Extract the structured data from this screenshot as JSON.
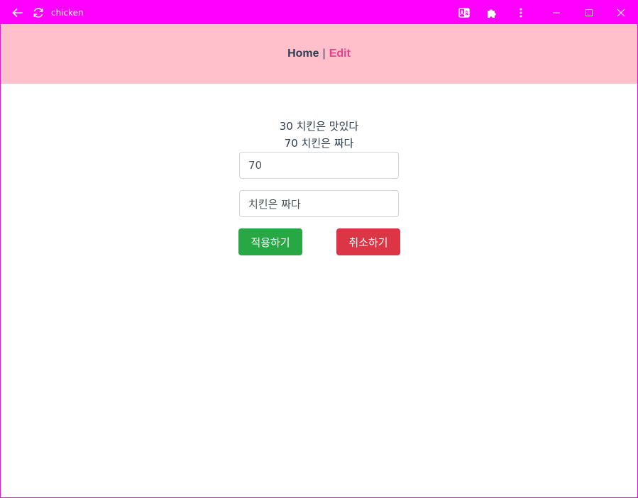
{
  "window": {
    "title": "chicken",
    "icons": {
      "back": "back-arrow-icon",
      "reload": "reload-icon",
      "translate": "translate-icon",
      "extensions": "puzzle-icon",
      "menu": "kebab-menu-icon",
      "minimize": "minimize-icon",
      "maximize": "maximize-icon",
      "close": "close-icon"
    },
    "accent": "#ff00ff"
  },
  "nav": {
    "home_label": "Home",
    "separator": "|",
    "edit_label": "Edit",
    "background": "#ffc0cb",
    "active_color": "#e83e8c"
  },
  "main": {
    "items": [
      "30 치킨은 맛있다",
      "70 치킨은 짜다"
    ],
    "score_value": "70",
    "comment_value": "치킨은 짜다",
    "apply_label": "적용하기",
    "cancel_label": "취소하기",
    "apply_color": "#28a745",
    "cancel_color": "#dc3545"
  }
}
